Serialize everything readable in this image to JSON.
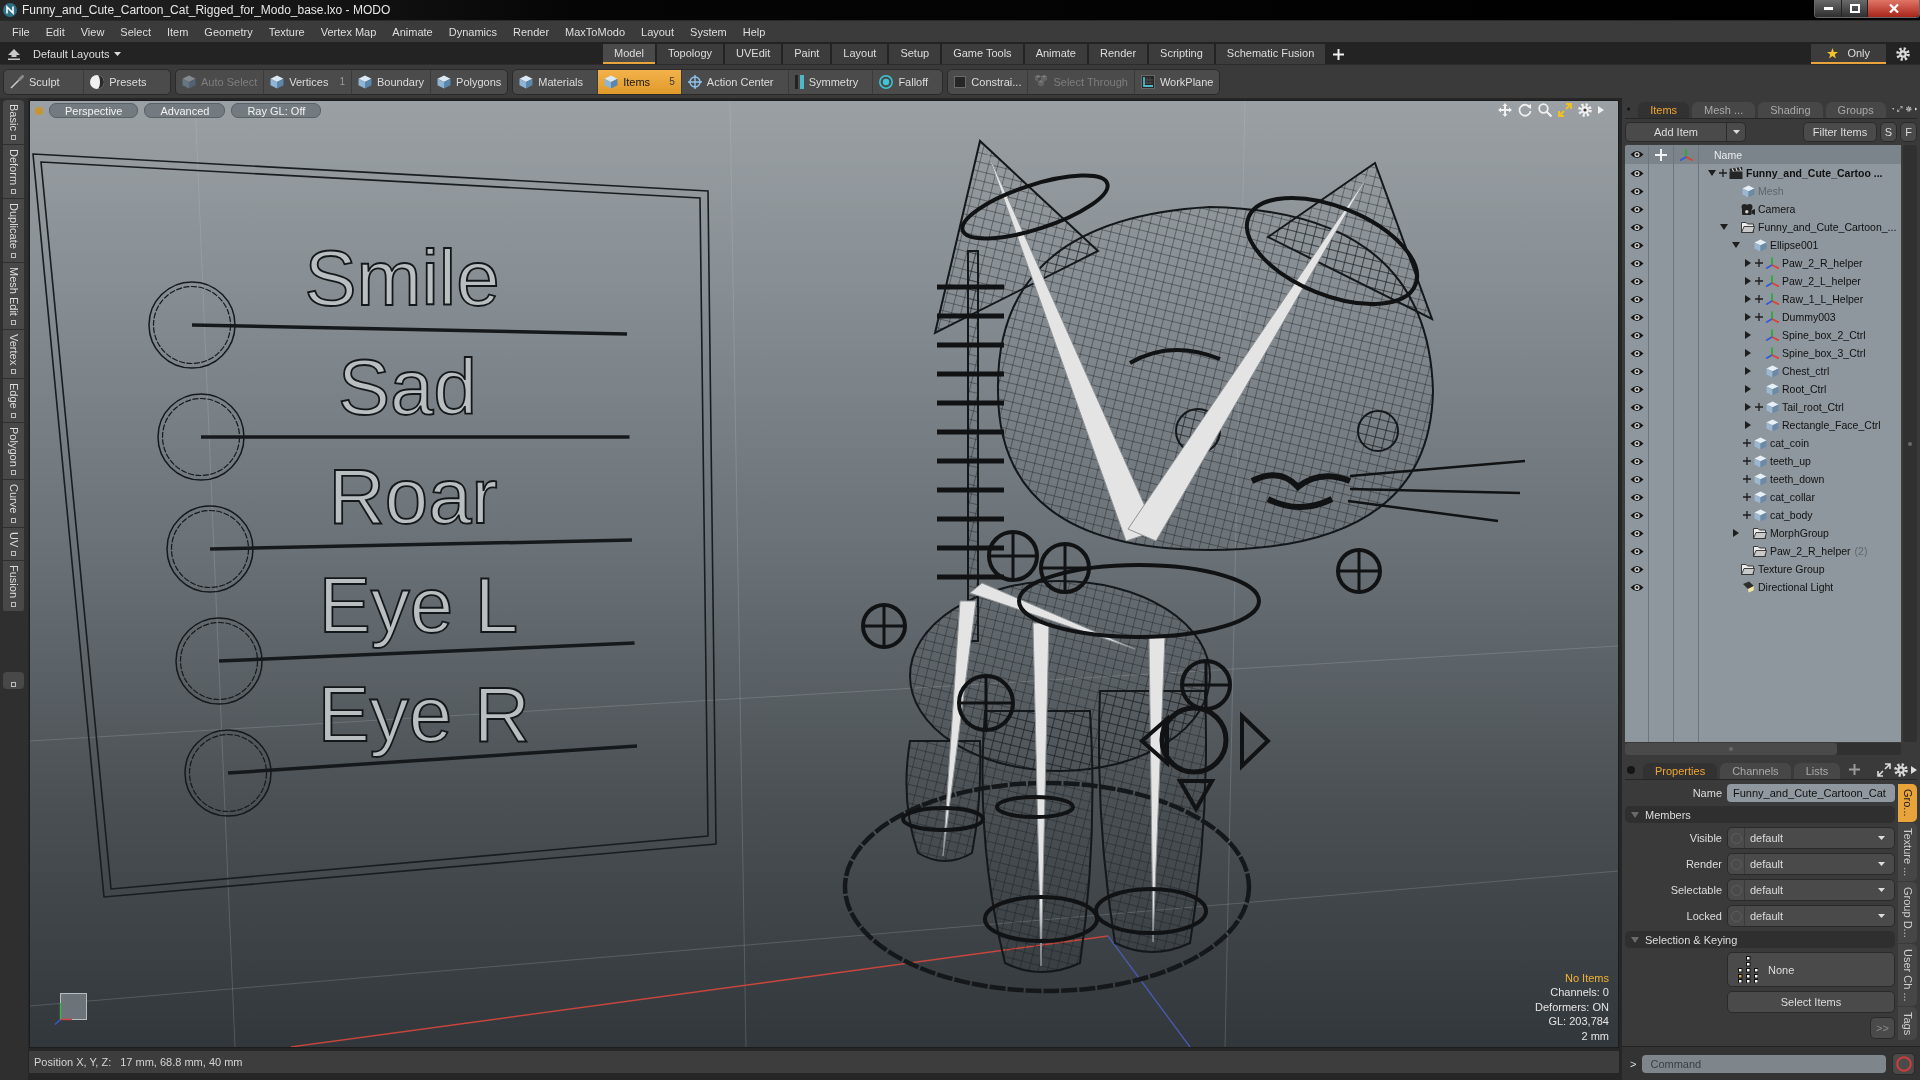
{
  "window": {
    "title": "Funny_and_Cute_Cartoon_Cat_Rigged_for_Modo_base.lxo - MODO"
  },
  "menu": [
    "File",
    "Edit",
    "View",
    "Select",
    "Item",
    "Geometry",
    "Texture",
    "Vertex Map",
    "Animate",
    "Dynamics",
    "Render",
    "MaxToModo",
    "Layout",
    "System",
    "Help"
  ],
  "layout_bar": {
    "layout_menu": "Default Layouts",
    "tabs": [
      {
        "label": "Model",
        "selected": true
      },
      {
        "label": "Topology",
        "selected": false
      },
      {
        "label": "UVEdit",
        "selected": false
      },
      {
        "label": "Paint",
        "selected": false
      },
      {
        "label": "Layout",
        "selected": false
      },
      {
        "label": "Setup",
        "selected": false
      },
      {
        "label": "Game Tools",
        "selected": false
      },
      {
        "label": "Animate",
        "selected": false
      },
      {
        "label": "Render",
        "selected": false
      },
      {
        "label": "Scripting",
        "selected": false
      },
      {
        "label": "Schematic Fusion",
        "selected": false
      }
    ],
    "only": {
      "label": "Only",
      "on": true
    }
  },
  "toolbar": {
    "groups": [
      {
        "items": [
          {
            "kind": "sculpt",
            "label": "Sculpt",
            "selected": false,
            "disabled": false
          },
          {
            "kind": "presets",
            "label": "Presets",
            "selected": false,
            "disabled": false
          }
        ]
      },
      {
        "items": [
          {
            "kind": "component",
            "label": "Auto Select",
            "selected": false,
            "disabled": true
          },
          {
            "kind": "component",
            "label": "Vertices",
            "count": "1",
            "selected": false,
            "disabled": false
          },
          {
            "kind": "component",
            "label": "Boundary",
            "selected": false,
            "disabled": false
          },
          {
            "kind": "component",
            "label": "Polygons",
            "selected": false,
            "disabled": false
          }
        ]
      },
      {
        "items": [
          {
            "kind": "component",
            "label": "Materials",
            "selected": false,
            "disabled": false
          },
          {
            "kind": "component",
            "label": "Items",
            "count": "5",
            "selected": true,
            "disabled": false
          },
          {
            "kind": "center",
            "label": "Action Center",
            "selected": false,
            "disabled": false
          },
          {
            "kind": "symmetry",
            "label": "Symmetry",
            "selected": false,
            "disabled": false
          },
          {
            "kind": "falloff",
            "label": "Falloff",
            "selected": false,
            "disabled": false
          }
        ]
      },
      {
        "items": [
          {
            "kind": "constraint",
            "label": "Constrai...",
            "selected": false,
            "disabled": false
          },
          {
            "kind": "through",
            "label": "Select Through",
            "selected": false,
            "disabled": true
          },
          {
            "kind": "workplane",
            "label": "WorkPlane",
            "selected": false,
            "disabled": false
          }
        ]
      }
    ]
  },
  "left_tabs": [
    "Basic",
    "Deform",
    "Duplicate",
    "Mesh Edit",
    "Vertex",
    "Edge",
    "Polygon",
    "Curve",
    "UV",
    "Fusion"
  ],
  "viewport": {
    "view_buttons": [
      "Perspective",
      "Advanced",
      "Ray GL: Off"
    ],
    "board_labels": [
      "Smile",
      "Sad",
      "Roar",
      "Eye L",
      "Eye R"
    ],
    "selection": "No Items",
    "info": [
      "Channels: 0",
      "Deformers: ON",
      "GL: 203,784",
      "2 mm"
    ]
  },
  "status_bar": {
    "label": "Position X, Y, Z:",
    "value": "17 mm, 68.8 mm, 40 mm"
  },
  "items_panel": {
    "tabs": [
      {
        "label": "Items",
        "selected": true
      },
      {
        "label": "Mesh ...",
        "selected": false
      },
      {
        "label": "Shading",
        "selected": false
      },
      {
        "label": "Groups",
        "selected": false
      }
    ],
    "add_item": "Add Item",
    "filter": "Filter Items",
    "filter_toggles": [
      "S",
      "F"
    ],
    "name_column": "Name",
    "tree": [
      {
        "name": "Funny_and_Cute_Cartoo ...",
        "kind": "scene",
        "expanded": true,
        "plus": true,
        "disabled": false,
        "children": [
          {
            "name": "Mesh",
            "kind": "mesh",
            "plus": false,
            "disabled": true
          },
          {
            "name": "Camera",
            "kind": "camera",
            "plus": false,
            "disabled": false
          },
          {
            "name": "Funny_and_Cute_Cartoon_...",
            "kind": "group",
            "expanded": true,
            "plus": false,
            "disabled": false,
            "children": [
              {
                "name": "Ellipse001",
                "kind": "mesh",
                "expanded": true,
                "plus": false,
                "disabled": false,
                "children": [
                  {
                    "name": "Paw_2_R_helper",
                    "kind": "locator",
                    "expanded": false,
                    "plus": true,
                    "disabled": false
                  },
                  {
                    "name": "Paw_2_L_helper",
                    "kind": "locator",
                    "expanded": false,
                    "plus": true,
                    "disabled": false
                  },
                  {
                    "name": "Raw_1_L_Helper",
                    "kind": "locator",
                    "expanded": false,
                    "plus": true,
                    "disabled": false
                  },
                  {
                    "name": "Dummy003",
                    "kind": "locator",
                    "expanded": false,
                    "plus": true,
                    "disabled": false
                  },
                  {
                    "name": "Spine_box_2_Ctrl",
                    "kind": "locator",
                    "expanded": false,
                    "plus": false,
                    "disabled": false
                  },
                  {
                    "name": "Spine_box_3_Ctrl",
                    "kind": "locator",
                    "expanded": false,
                    "plus": false,
                    "disabled": false
                  },
                  {
                    "name": "Chest_ctrl",
                    "kind": "mesh",
                    "expanded": false,
                    "plus": false,
                    "disabled": false
                  },
                  {
                    "name": "Root_Ctrl",
                    "kind": "mesh",
                    "expanded": false,
                    "plus": false,
                    "disabled": false
                  },
                  {
                    "name": "Tail_root_Ctrl",
                    "kind": "mesh",
                    "expanded": false,
                    "plus": true,
                    "disabled": false
                  },
                  {
                    "name": "Rectangle_Face_Ctrl",
                    "kind": "mesh",
                    "expanded": false,
                    "plus": false,
                    "disabled": false
                  }
                ]
              },
              {
                "name": "cat_coin",
                "kind": "mesh",
                "plus": true,
                "disabled": false
              },
              {
                "name": "teeth_up",
                "kind": "mesh",
                "plus": true,
                "disabled": false
              },
              {
                "name": "teeth_down",
                "kind": "mesh",
                "plus": true,
                "disabled": false
              },
              {
                "name": "cat_collar",
                "kind": "mesh",
                "plus": true,
                "disabled": false
              },
              {
                "name": "cat_body",
                "kind": "mesh",
                "plus": true,
                "disabled": false
              },
              {
                "name": "MorphGroup",
                "kind": "group",
                "expanded": false,
                "plus": false,
                "disabled": false
              },
              {
                "name": "Paw_2_R_helper",
                "suffix": "(2)",
                "kind": "group",
                "plus": false,
                "disabled": false
              }
            ]
          },
          {
            "name": "Texture Group",
            "kind": "group",
            "plus": false,
            "disabled": false
          },
          {
            "name": "Directional Light",
            "kind": "light",
            "plus": false,
            "disabled": false
          }
        ]
      }
    ]
  },
  "properties_panel": {
    "tabs": [
      {
        "label": "Properties",
        "selected": true
      },
      {
        "label": "Channels",
        "selected": false
      },
      {
        "label": "Lists",
        "selected": false
      }
    ],
    "name_label": "Name",
    "name_value": "Funny_and_Cute_Cartoon_Cat",
    "sections": [
      {
        "title": "Members",
        "expanded": true,
        "rows": [
          {
            "label": "Visible",
            "value": "default"
          },
          {
            "label": "Render",
            "value": "default"
          },
          {
            "label": "Selectable",
            "value": "default"
          },
          {
            "label": "Locked",
            "value": "default"
          }
        ]
      },
      {
        "title": "Selection & Keying",
        "expanded": true,
        "buttons": [
          {
            "kind": "preset",
            "label": "None"
          },
          {
            "kind": "action",
            "label": "Select Items"
          },
          {
            "kind": "more",
            "label": ">>"
          }
        ]
      }
    ],
    "side_tabs": [
      {
        "label": "Gro...",
        "selected": true
      },
      {
        "label": "Texture ...",
        "selected": false
      },
      {
        "label": "Group D...",
        "selected": false
      },
      {
        "label": "User Ch ...",
        "selected": false
      },
      {
        "label": "Tags",
        "selected": false
      }
    ]
  },
  "command": {
    "prompt": ">",
    "placeholder": "Command"
  }
}
